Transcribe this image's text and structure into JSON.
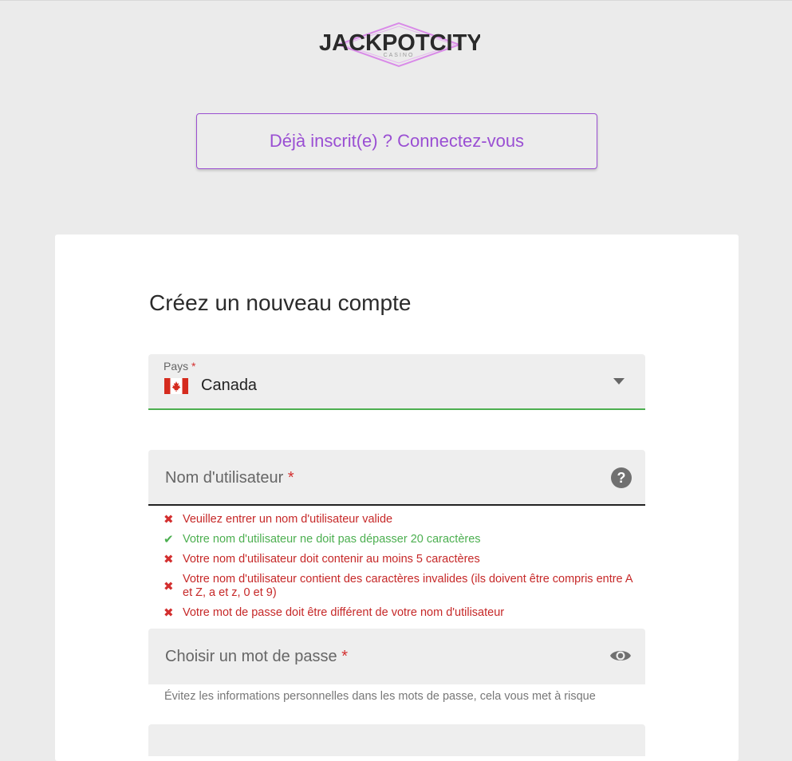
{
  "logo": {
    "main": "JACKPOTCITY",
    "sub": "CASINO"
  },
  "login_button": "Déjà inscrit(e) ? Connectez-vous",
  "form": {
    "title": "Créez un nouveau compte",
    "country": {
      "label": "Pays",
      "required": "*",
      "value": "Canada"
    },
    "username": {
      "placeholder": "Nom d'utilisateur",
      "required": "*"
    },
    "username_rules": [
      {
        "status": "invalid",
        "icon": "✖",
        "text": "Veuillez entrer un nom d'utilisateur valide"
      },
      {
        "status": "valid",
        "icon": "✔",
        "text": "Votre nom d'utilisateur ne doit pas dépasser 20 caractères"
      },
      {
        "status": "invalid",
        "icon": "✖",
        "text": "Votre nom d'utilisateur doit contenir au moins 5 caractères"
      },
      {
        "status": "invalid",
        "icon": "✖",
        "text": "Votre nom d'utilisateur contient des caractères invalides (ils doivent être compris entre A et Z, a et z, 0 et 9)"
      },
      {
        "status": "invalid",
        "icon": "✖",
        "text": "Votre mot de passe doit être différent de votre nom d'utilisateur"
      }
    ],
    "password": {
      "placeholder": "Choisir un mot de passe",
      "required": "*",
      "hint": "Évitez les informations personnelles dans les mots de passe, cela vous met à risque"
    }
  },
  "colors": {
    "accent": "#9a4fd3",
    "error": "#d32f2f",
    "success": "#4caf50",
    "background": "#ebebeb"
  }
}
